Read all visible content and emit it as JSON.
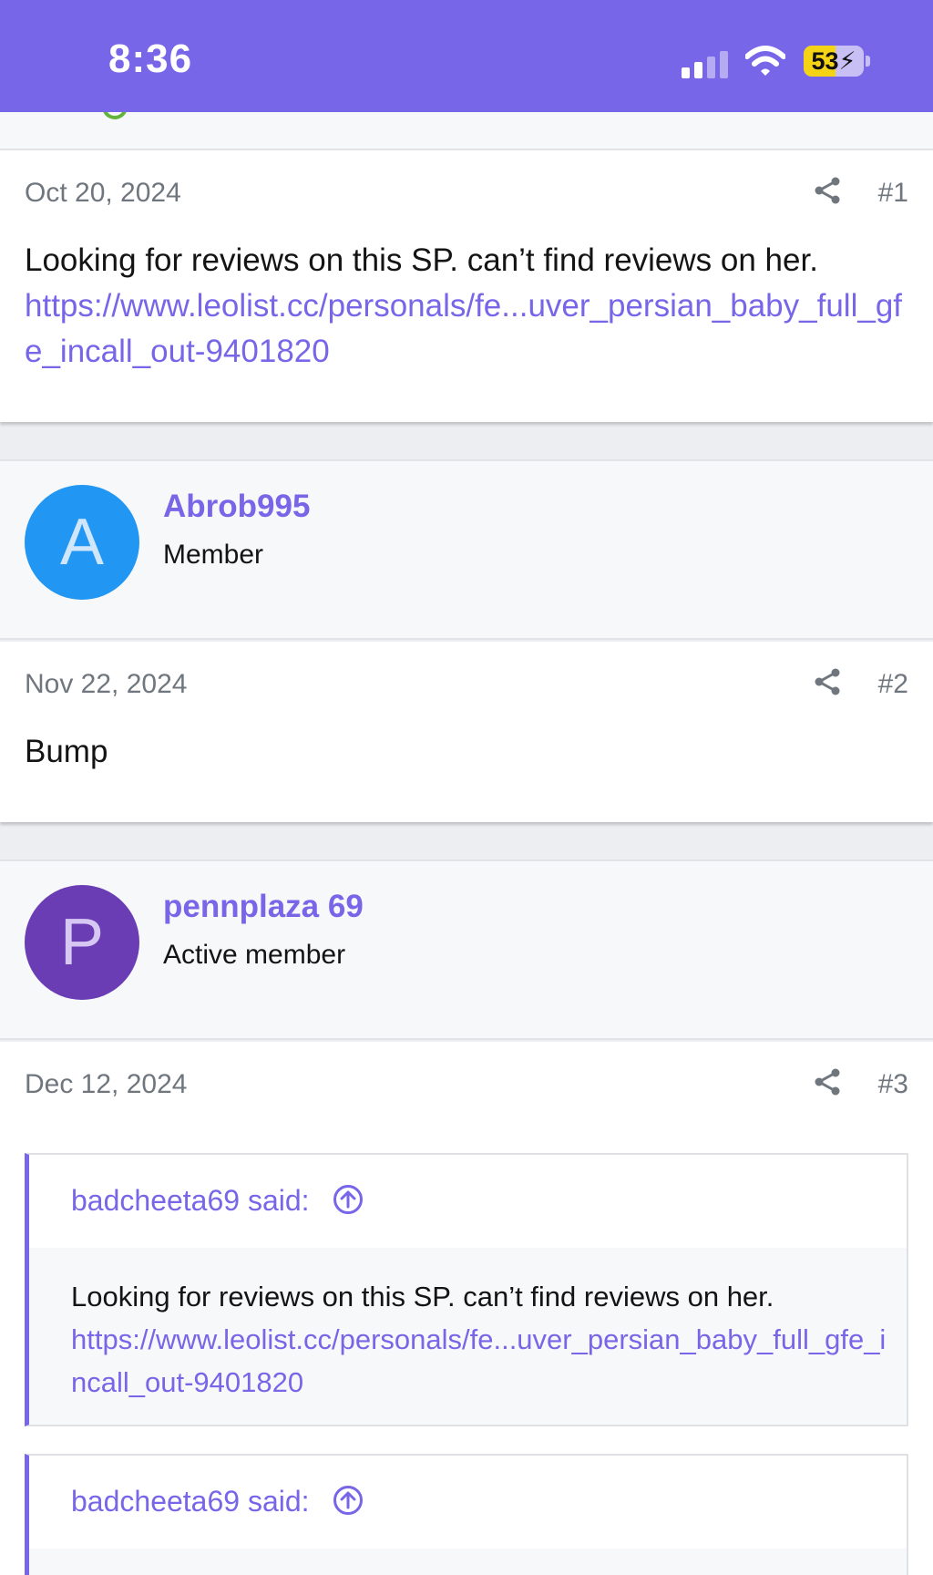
{
  "status_bar": {
    "time": "8:36",
    "battery": "53",
    "battery_level": 0.53,
    "colors": {
      "bar": "#7766e8",
      "battery": "#f5d416"
    }
  },
  "posts": [
    {
      "date": "Oct 20, 2024",
      "number": "#1",
      "text": "Looking for reviews on this SP. can’t find reviews on her.",
      "link": "https://www.leolist.cc/personals/fe...uver_persian_baby_full_gfe_incall_out-9401820"
    },
    {
      "date": "Nov 22, 2024",
      "number": "#2",
      "text": "Bump"
    },
    {
      "date": "Dec 12, 2024",
      "number": "#3",
      "quotes": [
        {
          "author": "badcheeta69 said:",
          "text": "Looking for reviews on this SP. can’t find reviews on her.",
          "link": "https://www.leolist.cc/personals/fe...uver_persian_baby_full_gfe_incall_out-9401820"
        },
        {
          "author": "badcheeta69 said:"
        }
      ]
    }
  ],
  "users": [
    {
      "initial": "A",
      "name": "Abrob995",
      "role": "Member",
      "avatar_bg": "#2196f3",
      "avatar_fg": "#cfe6fb"
    },
    {
      "initial": "P",
      "name": "pennplaza 69",
      "role": "Active member",
      "avatar_bg": "#6a3db5",
      "avatar_fg": "#d6c8f2"
    }
  ],
  "accent_color": "#7766e8"
}
